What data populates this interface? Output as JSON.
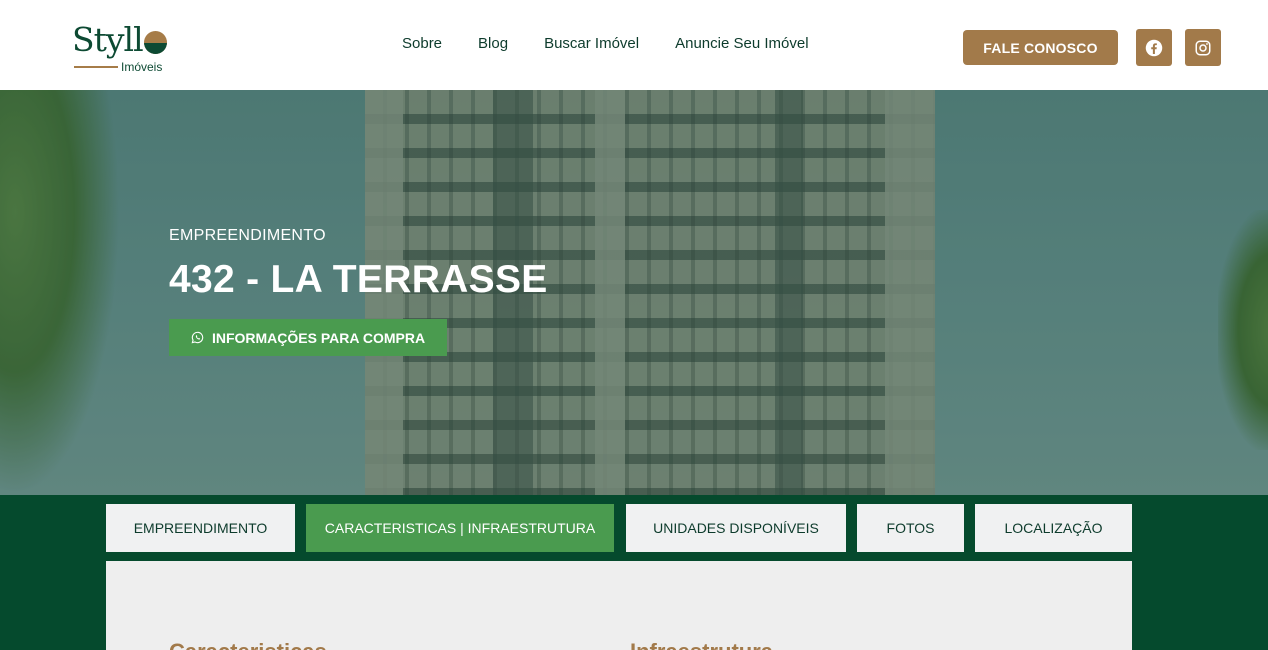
{
  "brand": {
    "logo_word": "Styll",
    "logo_sub": "Imóveis",
    "accent_gold": "#a27a4a",
    "accent_green": "#4a9b4f",
    "dark_green": "#054a2d"
  },
  "nav": {
    "items": [
      "Sobre",
      "Blog",
      "Buscar Imóvel",
      "Anuncie Seu Imóvel"
    ]
  },
  "header": {
    "cta_label": "FALE CONOSCO",
    "social": [
      "facebook-icon",
      "instagram-icon"
    ]
  },
  "hero": {
    "eyebrow": "EMPREENDIMENTO",
    "title": "432 -  LA TERRASSE",
    "button_label": "INFORMAÇÕES PARA COMPRA",
    "button_icon": "whatsapp-icon"
  },
  "tabs": [
    {
      "label": "EMPREENDIMENTO",
      "active": false
    },
    {
      "label": "CARACTERISTICAS | INFRAESTRUTURA",
      "active": true
    },
    {
      "label": "UNIDADES DISPONÍVEIS",
      "active": false
    },
    {
      "label": "FOTOS",
      "active": false
    },
    {
      "label": "LOCALIZAÇÃO",
      "active": false
    }
  ],
  "panel": {
    "left_heading": "Caracteristicas",
    "right_heading": "Infraestrutura"
  }
}
